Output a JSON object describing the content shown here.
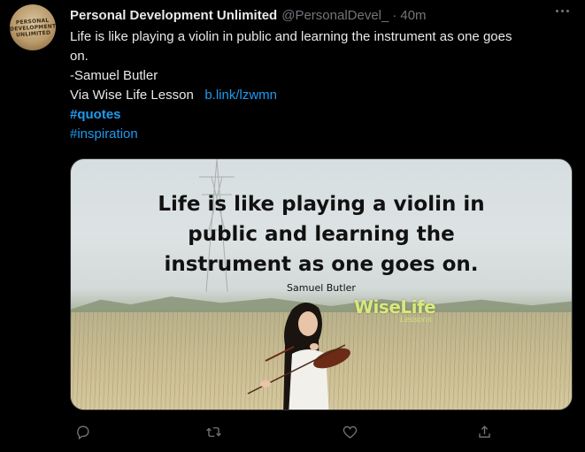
{
  "tweet": {
    "avatar": {
      "line1": "PERSONAL",
      "line2": "DEVELOPMENT",
      "line3": "UNLIMITED"
    },
    "display_name": "Personal Development Unlimited",
    "handle": "@PersonalDevel_",
    "separator": "·",
    "time": "40m",
    "text": {
      "line1": "Life is like playing a violin in public and learning the instrument as one goes",
      "line2": "on.",
      "line3": "-Samuel Butler",
      "via": "Via Wise Life Lesson",
      "link": "b.link/lzwmn",
      "hashtag1": "#quotes",
      "hashtag2": "#inspiration"
    },
    "media": {
      "quote_line1": "Life is like playing a violin in",
      "quote_line2": "public and learning the",
      "quote_line3": "instrument as one goes on.",
      "author": "Samuel Butler",
      "watermark_big": "WiseLife",
      "watermark_small": "Lessons"
    },
    "icons": {
      "more": "more-icon",
      "reply": "reply-icon",
      "retweet": "retweet-icon",
      "like": "like-icon",
      "share": "share-icon"
    },
    "colors": {
      "accent": "#1d9bf0",
      "muted": "#71767b",
      "text": "#e7e9ea",
      "background": "#000000"
    }
  }
}
